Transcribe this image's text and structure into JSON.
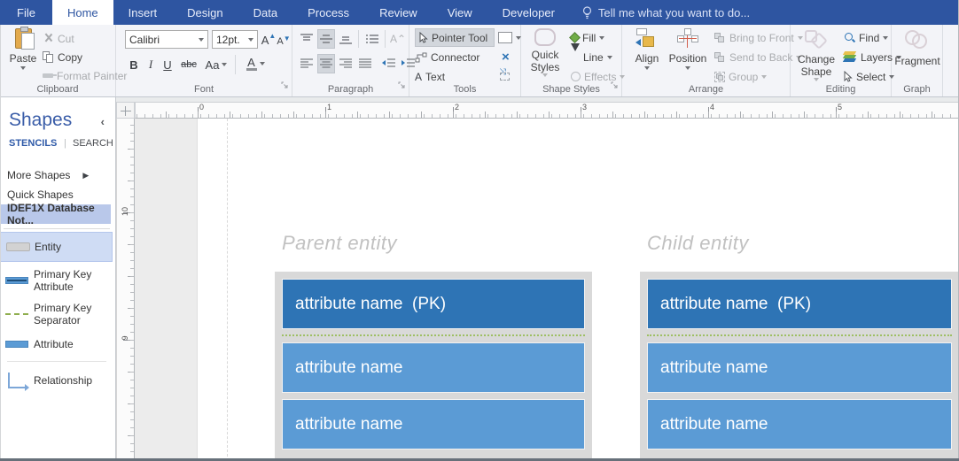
{
  "tabs": {
    "items": [
      "File",
      "Home",
      "Insert",
      "Design",
      "Data",
      "Process",
      "Review",
      "View",
      "Developer"
    ],
    "active": "Home",
    "tell_me": "Tell me what you want to do..."
  },
  "ribbon": {
    "clipboard": {
      "label": "Clipboard",
      "paste": "Paste",
      "cut": "Cut",
      "copy": "Copy",
      "format_painter": "Format Painter"
    },
    "font": {
      "label": "Font",
      "family": "Calibri",
      "size": "12pt.",
      "grow": "A",
      "shrink": "A",
      "bold": "B",
      "italic": "I",
      "underline": "U",
      "strike": "abc",
      "case_toggle": "Aa",
      "color": "A"
    },
    "paragraph": {
      "label": "Paragraph"
    },
    "tools": {
      "label": "Tools",
      "pointer_tool": "Pointer Tool",
      "connector": "Connector",
      "text": "Text",
      "text_a": "A"
    },
    "shape_styles": {
      "label": "Shape Styles",
      "quick_styles": "Quick Styles",
      "fill": "Fill",
      "line": "Line",
      "effects": "Effects"
    },
    "arrange": {
      "label": "Arrange",
      "align": "Align",
      "position": "Position",
      "bring_to_front": "Bring to Front",
      "send_to_back": "Send to Back",
      "group": "Group"
    },
    "editing": {
      "label": "Editing",
      "change_shape": "Change Shape",
      "find": "Find",
      "layers": "Layers",
      "select": "Select"
    },
    "graph": {
      "label": "Graph",
      "fragment": "Fragment"
    }
  },
  "shapes_panel": {
    "title": "Shapes",
    "stencils_tab": "STENCILS",
    "search_tab": "SEARCH",
    "more_shapes": "More Shapes",
    "quick_shapes": "Quick Shapes",
    "active_stencil": "IDEF1X Database Not...",
    "shapes": [
      {
        "label": "Entity"
      },
      {
        "label": "Primary Key Attribute"
      },
      {
        "label": "Primary Key Separator"
      },
      {
        "label": "Attribute"
      },
      {
        "label": "Relationship"
      }
    ]
  },
  "rulers": {
    "horizontal": [
      "0",
      "1",
      "2",
      "3",
      "4",
      "5"
    ],
    "vertical": [
      "10",
      "9"
    ]
  },
  "canvas": {
    "parent_entity": {
      "title": "Parent entity",
      "pk": "attribute name  (PK)",
      "attributes": [
        "attribute name",
        "attribute name"
      ]
    },
    "child_entity": {
      "title": "Child entity",
      "pk": "attribute name  (PK)",
      "attributes": [
        "attribute name",
        "attribute name"
      ]
    }
  },
  "colors": {
    "ribbon_blue": "#2e55a1",
    "pk_bar_blue": "#2e74b5",
    "attribute_bar_blue": "#5b9bd5",
    "entity_container_gray": "#d9d9d9",
    "separator_green": "#8fae4e",
    "stencil_highlight": "#b9c8ea",
    "selection_highlight": "#cfdcf4"
  }
}
